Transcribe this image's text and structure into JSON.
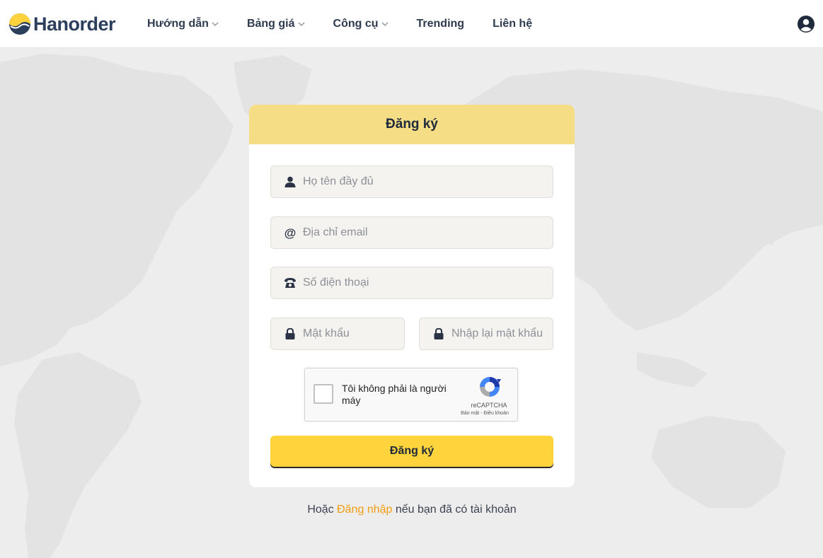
{
  "brand": {
    "name": "Hanorder",
    "colors": {
      "navy": "#2b3e5c",
      "yellow": "#fed33b",
      "accent": "#f39c12"
    }
  },
  "nav": {
    "items": [
      {
        "label": "Hướng dẫn",
        "has_dropdown": true
      },
      {
        "label": "Bảng giá",
        "has_dropdown": true
      },
      {
        "label": "Công cụ",
        "has_dropdown": true
      },
      {
        "label": "Trending",
        "has_dropdown": false
      },
      {
        "label": "Liên hệ",
        "has_dropdown": false
      }
    ],
    "account_icon": "user-circle-icon"
  },
  "register": {
    "title": "Đăng ký",
    "fields": {
      "fullname": {
        "placeholder": "Họ tên đầy đủ",
        "value": "",
        "icon": "user-icon"
      },
      "email": {
        "placeholder": "Địa chỉ email",
        "value": "",
        "icon": "at-icon"
      },
      "phone": {
        "placeholder": "Số điện thoại",
        "value": "",
        "icon": "phone-icon"
      },
      "password": {
        "placeholder": "Mật khẩu",
        "value": "",
        "icon": "lock-icon"
      },
      "password_confirm": {
        "placeholder": "Nhập lại mật khẩu",
        "value": "",
        "icon": "lock-icon"
      }
    },
    "captcha": {
      "label": "Tôi không phải là người máy",
      "brand": "reCAPTCHA",
      "privacy": "Bảo mật",
      "separator": " - ",
      "terms": "Điều khoản",
      "checked": false
    },
    "submit_label": "Đăng ký"
  },
  "footer": {
    "prefix": "Hoặc ",
    "login_link": "Đăng nhập",
    "suffix": " nếu bạn đã có tài khoản"
  }
}
